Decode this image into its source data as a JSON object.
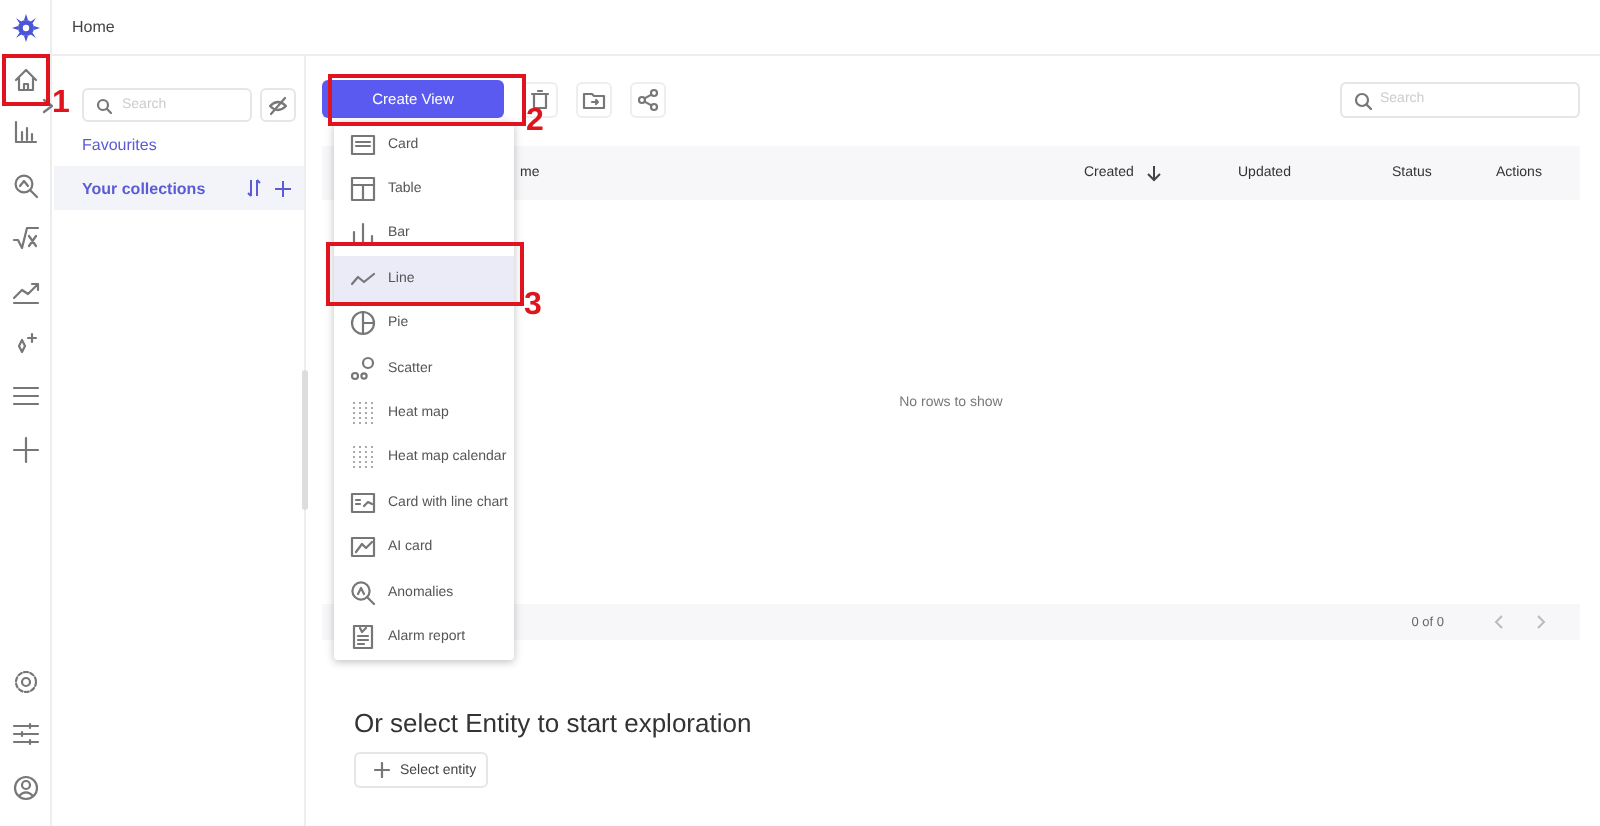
{
  "header": {
    "title": "Home"
  },
  "collections": {
    "search_placeholder": "Search",
    "items": [
      {
        "label": "Favourites",
        "selected": false
      },
      {
        "label": "Your collections",
        "selected": true
      }
    ]
  },
  "toolbar": {
    "create_button": "Create View",
    "search_placeholder": "Search"
  },
  "dropdown": {
    "items": [
      {
        "label": "Card",
        "kind": "card",
        "selected": false
      },
      {
        "label": "Table",
        "kind": "table",
        "selected": false
      },
      {
        "label": "Bar",
        "kind": "bar",
        "selected": false
      },
      {
        "label": "Line",
        "kind": "line",
        "selected": true
      },
      {
        "label": "Pie",
        "kind": "pie",
        "selected": false
      },
      {
        "label": "Scatter",
        "kind": "scatter",
        "selected": false
      },
      {
        "label": "Heat map",
        "kind": "heatmap",
        "selected": false
      },
      {
        "label": "Heat map calendar",
        "kind": "heatmap",
        "selected": false
      },
      {
        "label": "Card with line chart",
        "kind": "cardline",
        "selected": false
      },
      {
        "label": "AI card",
        "kind": "aicard",
        "selected": false
      },
      {
        "label": "Anomalies",
        "kind": "anomalies",
        "selected": false
      },
      {
        "label": "Alarm report",
        "kind": "report",
        "selected": false
      }
    ]
  },
  "table": {
    "columns": [
      {
        "label": "me",
        "sorted": false
      },
      {
        "label": "Created",
        "sorted": true
      },
      {
        "label": "Updated",
        "sorted": false
      },
      {
        "label": "Status",
        "sorted": false
      },
      {
        "label": "Actions",
        "sorted": false
      }
    ],
    "empty_text": "No rows to show",
    "pagination": "0 of 0"
  },
  "explore": {
    "heading": "Or select Entity to start exploration",
    "button": "Select entity"
  },
  "annotations": [
    {
      "label": "1"
    },
    {
      "label": "2"
    },
    {
      "label": "3"
    }
  ]
}
